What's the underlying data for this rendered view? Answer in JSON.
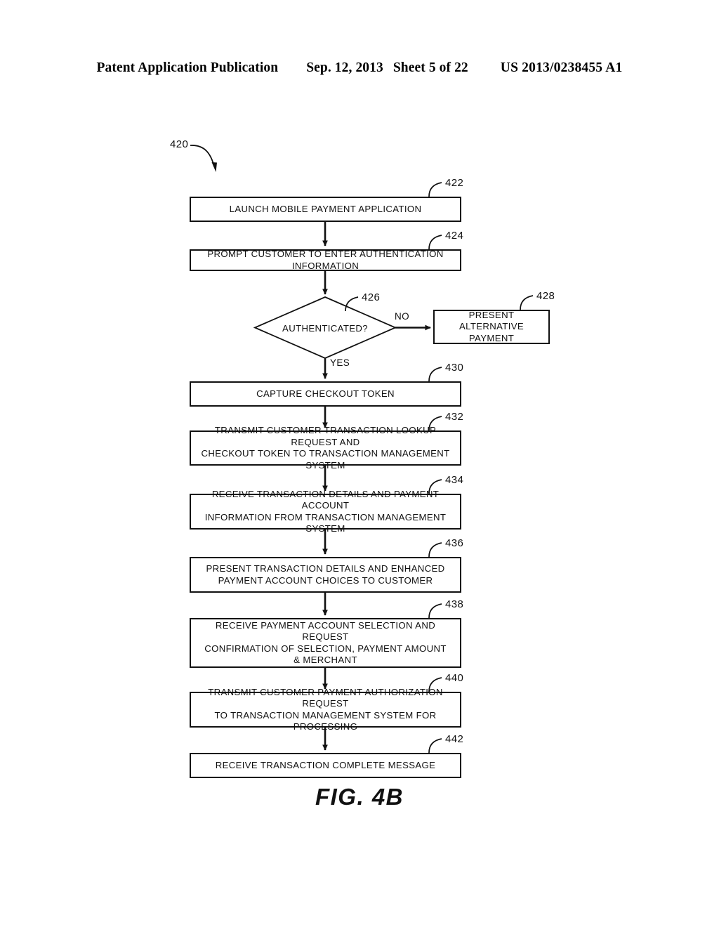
{
  "header": {
    "publication": "Patent Application Publication",
    "date": "Sep. 12, 2013",
    "sheet": "Sheet 5 of 22",
    "patent_number": "US 2013/0238455 A1"
  },
  "figure": {
    "caption": "FIG.  4B",
    "flow_ref": "420",
    "nodes": [
      {
        "ref": "422",
        "text": "LAUNCH MOBILE PAYMENT APPLICATION",
        "shape": "process"
      },
      {
        "ref": "424",
        "text": "PROMPT CUSTOMER TO ENTER AUTHENTICATION INFORMATION",
        "shape": "process"
      },
      {
        "ref": "426",
        "text": "AUTHENTICATED?",
        "shape": "decision"
      },
      {
        "ref": "428",
        "text": "PRESENT ALTERNATIVE\nPAYMENT",
        "shape": "process"
      },
      {
        "ref": "430",
        "text": "CAPTURE CHECKOUT TOKEN",
        "shape": "process"
      },
      {
        "ref": "432",
        "text": "TRANSMIT CUSTOMER TRANSACTION LOOKUP REQUEST AND\nCHECKOUT TOKEN TO TRANSACTION MANAGEMENT SYSTEM",
        "shape": "process"
      },
      {
        "ref": "434",
        "text": "RECEIVE TRANSACTION DETAILS AND PAYMENT ACCOUNT\nINFORMATION FROM TRANSACTION MANAGEMENT SYSTEM",
        "shape": "process"
      },
      {
        "ref": "436",
        "text": "PRESENT TRANSACTION DETAILS AND ENHANCED\nPAYMENT ACCOUNT CHOICES TO CUSTOMER",
        "shape": "process"
      },
      {
        "ref": "438",
        "text": "RECEIVE PAYMENT ACCOUNT SELECTION AND REQUEST\nCONFIRMATION OF SELECTION, PAYMENT AMOUNT\n& MERCHANT",
        "shape": "process"
      },
      {
        "ref": "440",
        "text": "TRANSMIT CUSTOMER PAYMENT AUTHORIZATION REQUEST\nTO TRANSACTION MANAGEMENT SYSTEM FOR PROCESSING",
        "shape": "process"
      },
      {
        "ref": "442",
        "text": "RECEIVE TRANSACTION COMPLETE MESSAGE",
        "shape": "process"
      }
    ],
    "branch_labels": {
      "no": "NO",
      "yes": "YES"
    }
  }
}
